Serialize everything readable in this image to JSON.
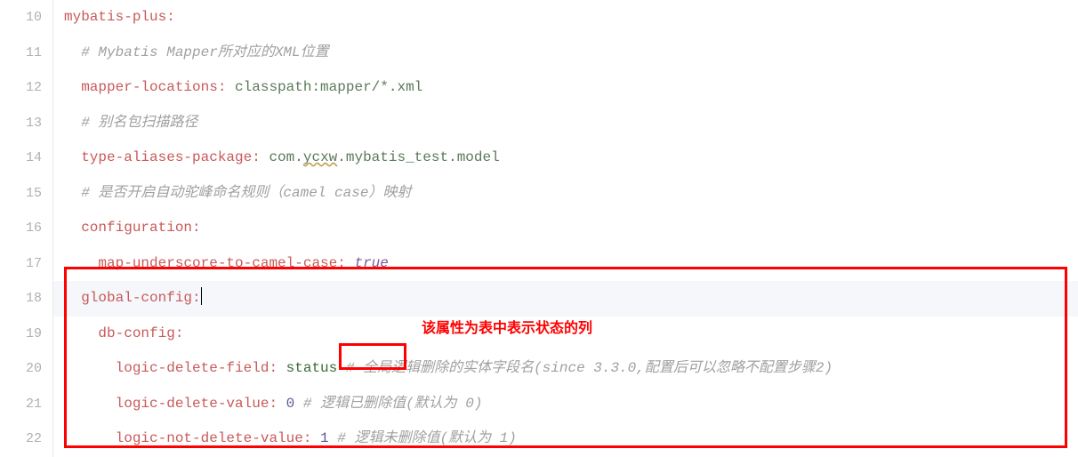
{
  "gutter": {
    "start": 10,
    "end": 22
  },
  "lines": {
    "10": {
      "indent": 0,
      "key": "mybatis-plus",
      "val": ""
    },
    "11": {
      "indent": 1,
      "comment": "# Mybatis Mapper所对应的XML位置"
    },
    "12": {
      "indent": 1,
      "key": "mapper-locations",
      "val": " classpath:mapper/*.xml"
    },
    "13": {
      "indent": 1,
      "comment": "# 别名包扫描路径"
    },
    "14": {
      "indent": 1,
      "key": "type-aliases-package",
      "val_pre": " com.",
      "val_wavy": "ycxw",
      "val_post": ".mybatis_test.model"
    },
    "15": {
      "indent": 1,
      "comment": "# 是否开启自动驼峰命名规则（camel case）映射"
    },
    "16": {
      "indent": 1,
      "key": "configuration",
      "val": ""
    },
    "17": {
      "indent": 2,
      "key": "map-underscore-to-camel-case",
      "val_bool": " true"
    },
    "18": {
      "indent": 1,
      "key": "global-config",
      "val": ""
    },
    "19": {
      "indent": 2,
      "key": "db-config",
      "val": ""
    },
    "20": {
      "indent": 3,
      "key": "logic-delete-field",
      "val_status": " status ",
      "comment_inline": "# 全局逻辑删除的实体字段名(since 3.3.0,配置后可以忽略不配置步骤2)"
    },
    "21": {
      "indent": 3,
      "key": "logic-delete-value",
      "val_num": " 0 ",
      "comment_inline": "# 逻辑已删除值(默认为 0)"
    },
    "22": {
      "indent": 3,
      "key": "logic-not-delete-value",
      "val_num": " 1 ",
      "comment_inline": "# 逻辑未删除值(默认为 1)"
    }
  },
  "annotation_text": "该属性为表中表示状态的列"
}
